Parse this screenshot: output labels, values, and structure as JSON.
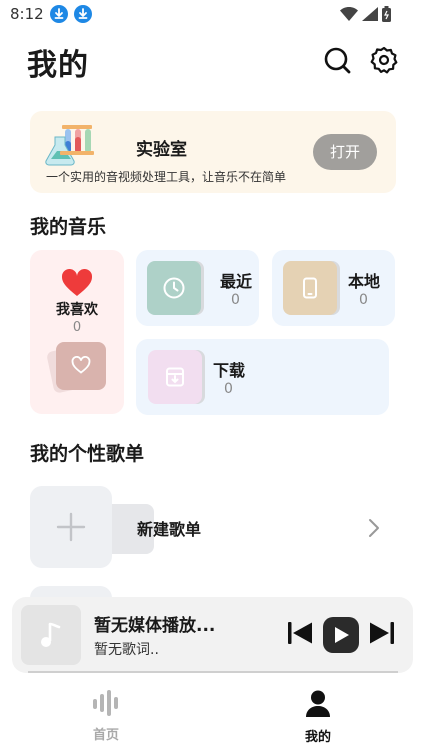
{
  "status_bar": {
    "time": "8:12"
  },
  "header": {
    "title": "我的"
  },
  "lab": {
    "title": "实验室",
    "subtitle": "一个实用的音视频处理工具，让音乐不在简单",
    "open_label": "打开"
  },
  "my_music": {
    "title": "我的音乐",
    "favorites": {
      "label": "我喜欢",
      "count": "0"
    },
    "recent": {
      "label": "最近",
      "count": "0"
    },
    "local": {
      "label": "本地",
      "count": "0"
    },
    "downloads": {
      "label": "下载",
      "count": "0"
    }
  },
  "playlists": {
    "title": "我的个性歌单",
    "new_label": "新建歌单"
  },
  "player": {
    "title": "暂无媒体播放...",
    "lyrics": "暂无歌词.."
  },
  "nav": {
    "home_label": "首页",
    "mine_label": "我的"
  },
  "colors": {
    "lab_bg": "#fdf6ea",
    "fav_bg": "#fff0f0",
    "card_bg": "#eef5fd",
    "heart": "#ee3b3b",
    "download_badge": "#1e88e5"
  }
}
